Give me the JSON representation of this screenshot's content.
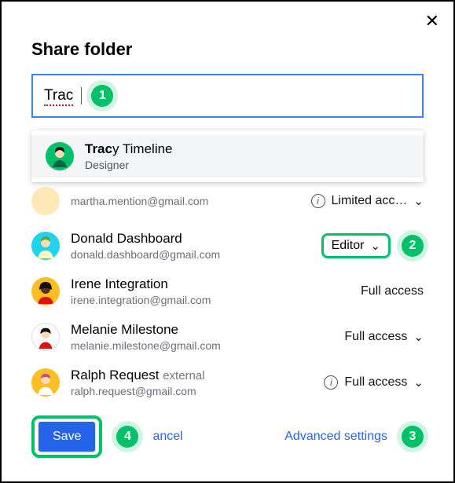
{
  "dialog": {
    "title": "Share folder"
  },
  "search": {
    "typed": "Trac"
  },
  "suggestion": {
    "name_prefix": "Trac",
    "name_rest": "y Timeline",
    "role": "Designer"
  },
  "partial_user": {
    "email": "martha.mention@gmail.com",
    "access": "Limited acc…"
  },
  "users": [
    {
      "name": "Donald Dashboard",
      "email": "donald.dashboard@gmail.com",
      "access": "Editor",
      "pill": true,
      "chevron": true
    },
    {
      "name": "Irene Integration",
      "email": "irene.integration@gmail.com",
      "access": "Full access",
      "chevron": false
    },
    {
      "name": "Melanie Milestone",
      "email": "melanie.milestone@gmail.com",
      "access": "Full access",
      "chevron": true
    },
    {
      "name": "Ralph Request",
      "external_tag": "external",
      "email": "ralph.request@gmail.com",
      "access": "Full access",
      "chevron": true,
      "info": true
    }
  ],
  "footer": {
    "save": "Save",
    "cancel": "ancel",
    "advanced": "Advanced settings"
  },
  "steps": {
    "s1": "1",
    "s2": "2",
    "s3": "3",
    "s4": "4"
  }
}
